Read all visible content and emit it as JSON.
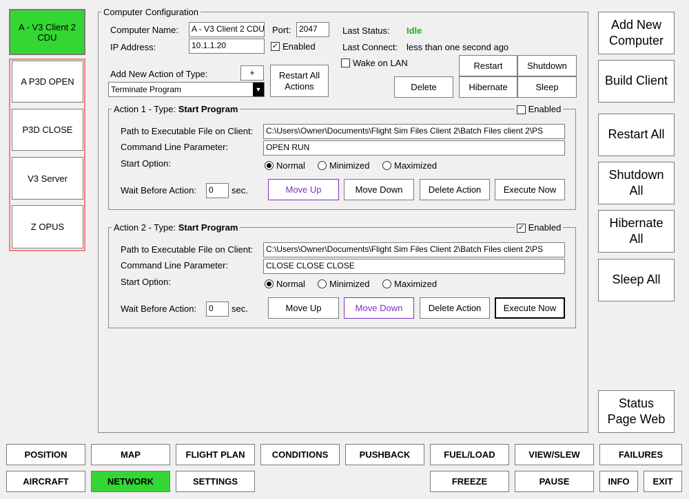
{
  "colors": {
    "active_green": "#33d633",
    "status_idle": "#2ea82e",
    "inactive_border": "#f08080",
    "move_purple": "#7b2fbf"
  },
  "computers": [
    {
      "label": "A - V3 Client 2 CDU",
      "state": "active"
    },
    {
      "label": "A P3D OPEN",
      "state": "inactive"
    },
    {
      "label": "P3D CLOSE",
      "state": "inactive"
    },
    {
      "label": "V3 Server",
      "state": "inactive"
    },
    {
      "label": "Z OPUS",
      "state": "inactive"
    }
  ],
  "config": {
    "legend": "Computer Configuration",
    "name_label": "Computer Name:",
    "name_value": "A - V3 Client 2 CDU",
    "port_label": "Port:",
    "port_value": "2047",
    "ip_label": "IP Address:",
    "ip_value": "10.1.1.20",
    "enabled_label": "Enabled",
    "enabled_checked": "✓",
    "last_status_label": "Last Status:",
    "last_status_value": "Idle",
    "last_connect_label": "Last Connect:",
    "last_connect_value": "less than one second ago",
    "wake_label": "Wake on LAN",
    "add_action_label": "Add New Action of Type:",
    "add_button": "+",
    "action_type_value": "Terminate Program",
    "restart_all_actions": "Restart All Actions",
    "delete_button": "Delete",
    "restart_button": "Restart",
    "shutdown_button": "Shutdown",
    "hibernate_button": "Hibernate",
    "sleep_button": "Sleep"
  },
  "actions": [
    {
      "legend_prefix": "Action 1 - Type: ",
      "legend_type": "Start Program",
      "enabled_label": "Enabled",
      "enabled_mark": "",
      "path_label": "Path to Executable File on Client:",
      "path_value": "C:\\Users\\Owner\\Documents\\Flight Sim Files Client 2\\Batch Files client 2\\PS",
      "cmd_label": "Command Line Parameter:",
      "cmd_value": "OPEN RUN",
      "start_label": "Start Option:",
      "opt_normal": "Normal",
      "opt_min": "Minimized",
      "opt_max": "Maximized",
      "wait_label": "Wait Before Action:",
      "wait_value": "0",
      "wait_unit": "sec.",
      "move_up": "Move Up",
      "move_down": "Move Down",
      "delete_action": "Delete Action",
      "execute_now": "Execute Now"
    },
    {
      "legend_prefix": "Action 2 - Type: ",
      "legend_type": "Start Program",
      "enabled_label": "Enabled",
      "enabled_mark": "✓",
      "path_label": "Path to Executable File on Client:",
      "path_value": "C:\\Users\\Owner\\Documents\\Flight Sim Files Client 2\\Batch Files client 2\\PS",
      "cmd_label": "Command Line Parameter:",
      "cmd_value": "CLOSE CLOSE CLOSE",
      "start_label": "Start Option:",
      "opt_normal": "Normal",
      "opt_min": "Minimized",
      "opt_max": "Maximized",
      "wait_label": "Wait Before Action:",
      "wait_value": "0",
      "wait_unit": "sec.",
      "move_up": "Move Up",
      "move_down": "Move Down",
      "delete_action": "Delete Action",
      "execute_now": "Execute Now"
    }
  ],
  "right_panel": {
    "add_new_computer": "Add New Computer",
    "build_client": "Build Client",
    "restart_all": "Restart All",
    "shutdown_all": "Shutdown All",
    "hibernate_all": "Hibernate All",
    "sleep_all": "Sleep All",
    "status_page_web": "Status Page Web"
  },
  "nav_row1": [
    "POSITION",
    "MAP",
    "FLIGHT PLAN",
    "CONDITIONS",
    "PUSHBACK",
    "FUEL/LOAD",
    "VIEW/SLEW",
    "FAILURES"
  ],
  "nav_row2": {
    "aircraft": "AIRCRAFT",
    "network": "NETWORK",
    "settings": "SETTINGS",
    "freeze": "FREEZE",
    "pause": "PAUSE",
    "info": "INFO",
    "exit": "EXIT"
  }
}
